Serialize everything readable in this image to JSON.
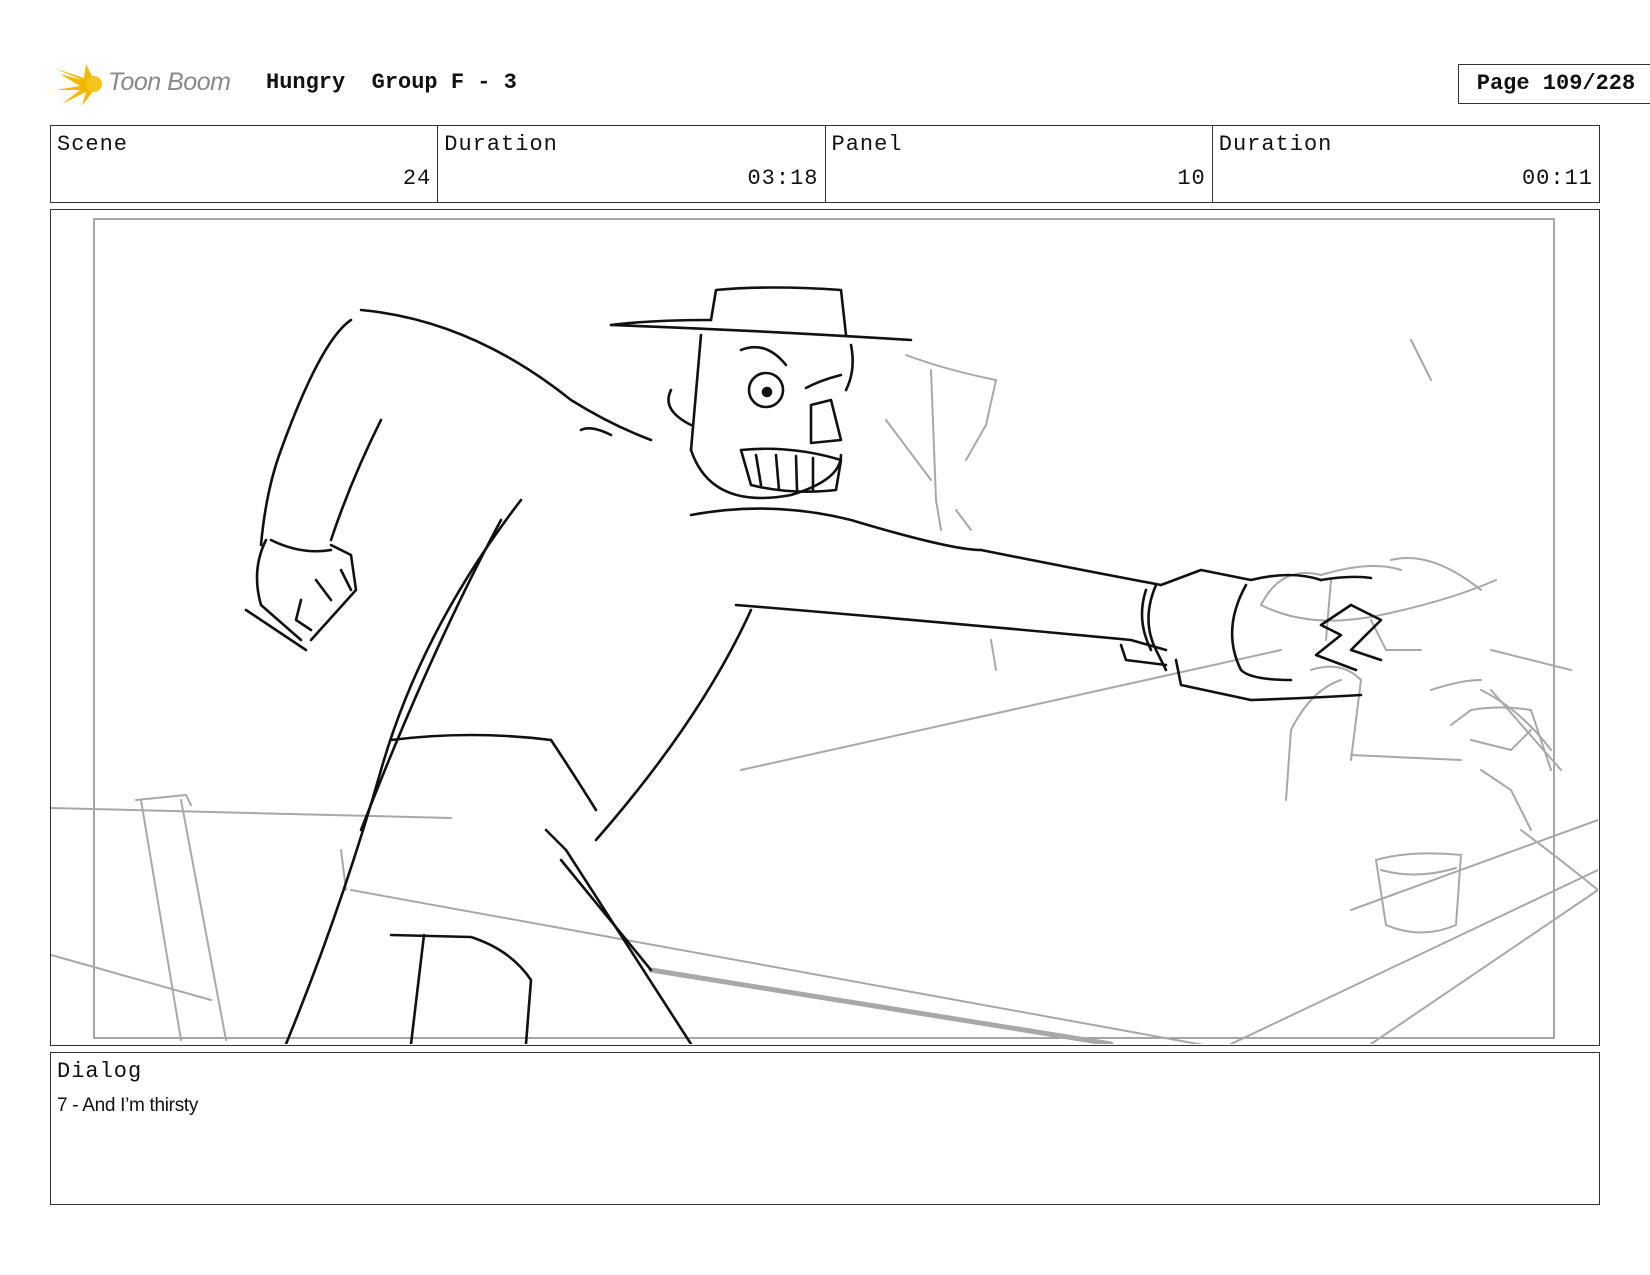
{
  "header": {
    "logo_text": "Toon Boom",
    "project_title": "Hungry  Group F - 3",
    "page_label": "Page 109/228"
  },
  "info": {
    "scene_label": "Scene",
    "scene_value": "24",
    "scene_duration_label": "Duration",
    "scene_duration_value": "03:18",
    "panel_label": "Panel",
    "panel_value": "10",
    "panel_duration_label": "Duration",
    "panel_duration_value": "00:11"
  },
  "dialog": {
    "label": "Dialog",
    "text": "7 - And I’m thirsty"
  },
  "colors": {
    "logo_accent": "#f5b800",
    "ink": "#111111",
    "rough_sketch": "#a8a8a8"
  }
}
